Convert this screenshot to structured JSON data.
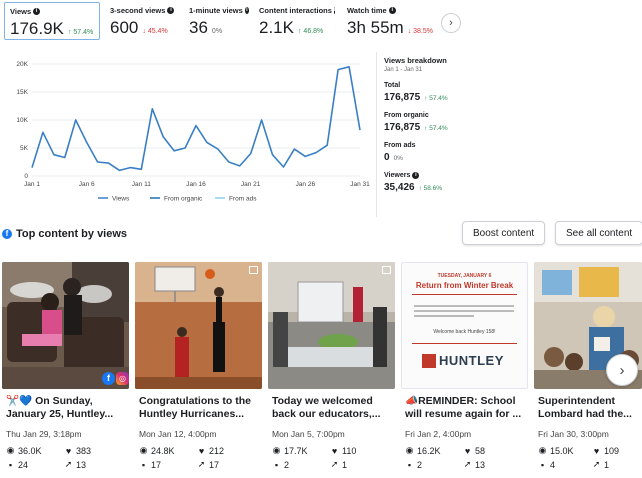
{
  "metrics": [
    {
      "label": "Views",
      "value": "176.9K",
      "change": "↑ 57.4%",
      "trend": "up",
      "selected": true
    },
    {
      "label": "3-second views",
      "value": "600",
      "change": "↓ 45.4%",
      "trend": "down"
    },
    {
      "label": "1-minute views",
      "value": "36",
      "change": "0%",
      "trend": "flat"
    },
    {
      "label": "Content interactions",
      "value": "2.1K",
      "change": "↑ 46.8%",
      "trend": "up"
    },
    {
      "label": "Watch time",
      "value": "3h 55m",
      "change": "↓ 38.5%",
      "trend": "down"
    }
  ],
  "chart_data": {
    "type": "line",
    "x_labels": [
      "Jan 1",
      "Jan 6",
      "Jan 11",
      "Jan 16",
      "Jan 21",
      "Jan 26",
      "Jan 31"
    ],
    "y_ticks": [
      "0",
      "5K",
      "10K",
      "15K",
      "20K"
    ],
    "ylim": [
      0,
      20000
    ],
    "x": [
      1,
      2,
      3,
      4,
      5,
      6,
      7,
      8,
      9,
      10,
      11,
      12,
      13,
      14,
      15,
      16,
      17,
      18,
      19,
      20,
      21,
      22,
      23,
      24,
      25,
      26,
      27,
      28,
      29,
      30,
      31
    ],
    "series": [
      {
        "name": "Views",
        "color": "#3a7fc4",
        "values": [
          1500,
          7800,
          3800,
          3300,
          10000,
          6000,
          2500,
          2300,
          1000,
          1500,
          1200,
          12000,
          7000,
          4500,
          5000,
          9000,
          6000,
          4800,
          2500,
          1800,
          4000,
          10000,
          3800,
          1600,
          4800,
          3500,
          4200,
          5500,
          19000,
          19500,
          8200
        ]
      },
      {
        "name": "From organic",
        "color": "#1a6fb0"
      },
      {
        "name": "From ads",
        "color": "#8ecdf2"
      }
    ],
    "legend_position": "bottom",
    "grid": true
  },
  "breakdown": {
    "title": "Views breakdown",
    "range": "Jan 1 - Jan 31",
    "items": [
      {
        "label": "Total",
        "value": "176,875",
        "change": "↑ 57.4%",
        "trend": "up"
      },
      {
        "label": "From organic",
        "value": "176,875",
        "change": "↑ 57.4%",
        "trend": "up"
      },
      {
        "label": "From ads",
        "value": "0",
        "change": "0%",
        "trend": "flat"
      },
      {
        "label": "Viewers",
        "value": "35,426",
        "change": "↑ 58.6%",
        "trend": "up"
      }
    ]
  },
  "top_content": {
    "title": "Top content by views",
    "boost_label": "Boost content",
    "see_all_label": "See all content"
  },
  "cards": [
    {
      "title": "✂️💙 On Sunday, January 25, Huntley...",
      "date": "Thu Jan 29, 3:18pm",
      "views": "36.0K",
      "likes": "383",
      "comments": "24",
      "shares": "13"
    },
    {
      "title": "Congratulations to the Huntley Hurricanes...",
      "date": "Mon Jan 12, 4:00pm",
      "views": "24.8K",
      "likes": "212",
      "comments": "17",
      "shares": "17"
    },
    {
      "title": "Today we welcomed back our educators,...",
      "date": "Mon Jan 5, 7:00pm",
      "views": "17.7K",
      "likes": "110",
      "comments": "2",
      "shares": "1"
    },
    {
      "title": "📣REMINDER: School will resume again for ...",
      "date": "Fri Jan 2, 4:00pm",
      "views": "16.2K",
      "likes": "58",
      "comments": "2",
      "shares": "13"
    },
    {
      "title": "Superintendent Lombard had the...",
      "date": "Fri Jan 30, 3:00pm",
      "views": "15.0K",
      "likes": "109",
      "comments": "4",
      "shares": "1"
    }
  ],
  "flyer": {
    "date_line": "TUESDAY, JANUARY 6",
    "headline": "Return from Winter Break",
    "welcome": "Welcome back Huntley 158!",
    "logo": "HUNTLEY"
  }
}
